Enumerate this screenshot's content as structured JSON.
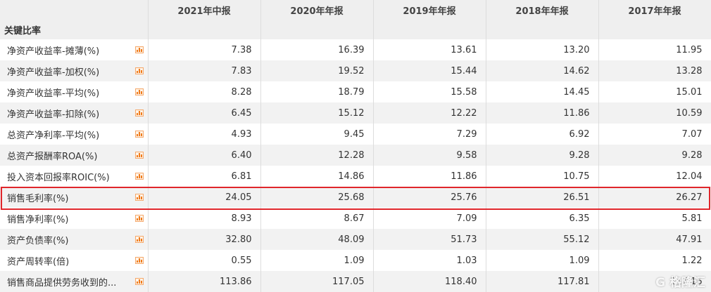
{
  "headers": [
    "",
    "2021年中报",
    "2020年年报",
    "2019年年报",
    "2018年年报",
    "2017年年报"
  ],
  "section": "关键比率",
  "rows": [
    {
      "label": "净资产收益率-摊薄(%)",
      "values": [
        "7.38",
        "16.39",
        "13.61",
        "13.20",
        "11.95"
      ]
    },
    {
      "label": "净资产收益率-加权(%)",
      "values": [
        "7.83",
        "19.52",
        "15.44",
        "14.62",
        "13.28"
      ]
    },
    {
      "label": "净资产收益率-平均(%)",
      "values": [
        "8.28",
        "18.79",
        "15.58",
        "14.45",
        "15.01"
      ]
    },
    {
      "label": "净资产收益率-扣除(%)",
      "values": [
        "6.45",
        "15.12",
        "12.22",
        "11.86",
        "10.59"
      ]
    },
    {
      "label": "总资产净利率-平均(%)",
      "values": [
        "4.93",
        "9.45",
        "7.29",
        "6.92",
        "7.07"
      ]
    },
    {
      "label": "总资产报酬率ROA(%)",
      "values": [
        "6.40",
        "12.28",
        "9.58",
        "9.28",
        "9.28"
      ]
    },
    {
      "label": "投入资本回报率ROIC(%)",
      "values": [
        "6.81",
        "14.86",
        "11.86",
        "10.75",
        "12.04"
      ]
    },
    {
      "label": "销售毛利率(%)",
      "values": [
        "24.05",
        "25.68",
        "25.76",
        "26.51",
        "26.27"
      ]
    },
    {
      "label": "销售净利率(%)",
      "values": [
        "8.93",
        "8.67",
        "7.09",
        "6.35",
        "5.81"
      ]
    },
    {
      "label": "资产负债率(%)",
      "values": [
        "32.80",
        "48.09",
        "51.73",
        "55.12",
        "47.91"
      ]
    },
    {
      "label": "资产周转率(倍)",
      "values": [
        "0.55",
        "1.09",
        "1.03",
        "1.09",
        "1.22"
      ]
    },
    {
      "label": "销售商品提供劳务收到的...",
      "values": [
        "113.86",
        "117.05",
        "118.40",
        "117.81",
        "117.16"
      ]
    }
  ],
  "watermark": "格隆汇"
}
